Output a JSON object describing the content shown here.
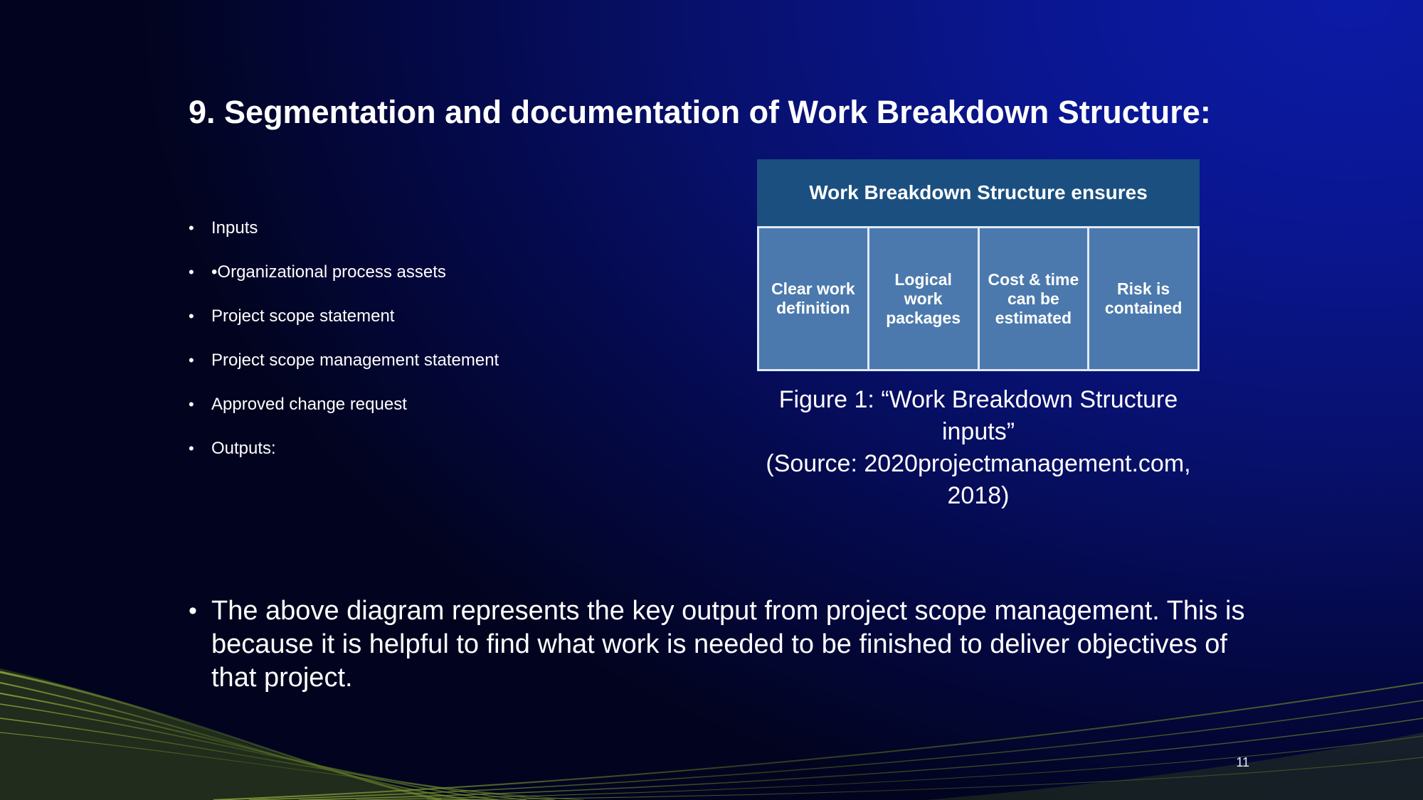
{
  "slide": {
    "title": "9. Segmentation and documentation of Work Breakdown Structure:",
    "bullet_symbol": "•",
    "bullets": [
      "Inputs",
      "•Organizational process assets",
      "Project scope statement",
      "Project scope management statement",
      "Approved change request",
      "Outputs:"
    ],
    "figure": {
      "header": "Work Breakdown Structure ensures",
      "cells": [
        "Clear work definition",
        "Logical work packages",
        "Cost & time can be estimated",
        "Risk is contained"
      ],
      "caption_lines": [
        "Figure 1: “Work Breakdown Structure",
        "inputs”",
        "(Source: 2020projectmanagement.com,",
        "2018)"
      ]
    },
    "paragraph": "The above diagram represents the key output from project scope management. This is because it is helpful to find what work is needed to be finished to deliver objectives of that project.",
    "page_number": "11"
  },
  "colors": {
    "background_dark": "#02041f",
    "background_accent": "#0c1ba6",
    "wbs_header": "#1b4f80",
    "wbs_cell": "#4b79ad",
    "wave_accent": "#6f8a2a"
  }
}
